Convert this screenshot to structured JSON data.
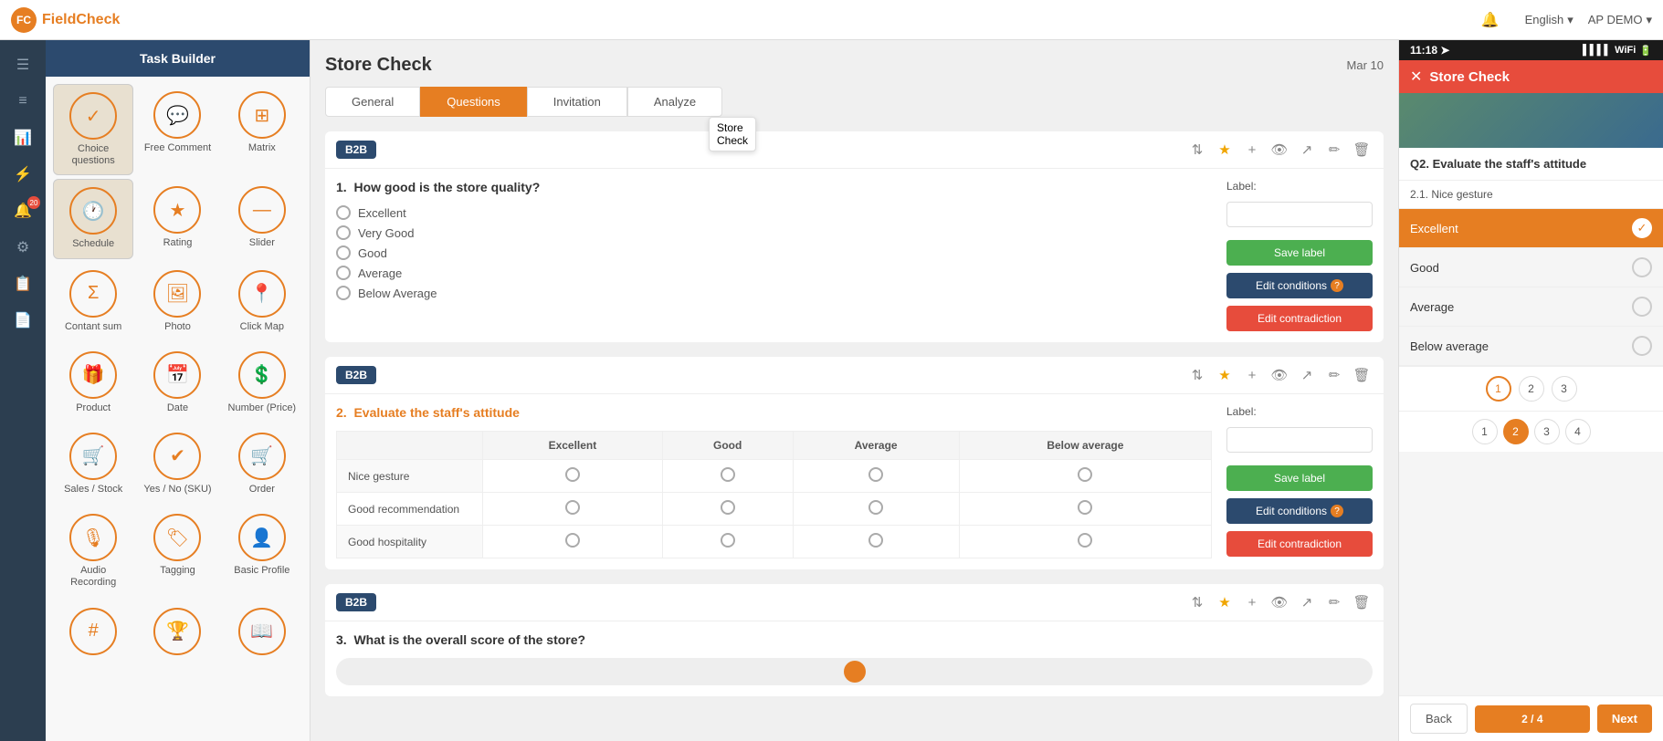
{
  "topbar": {
    "logo_text": "FieldCheck",
    "notification_icon": "🔔",
    "language": "English",
    "language_arrow": "▾",
    "user": "AP DEMO",
    "user_arrow": "▾"
  },
  "nav_sidebar": {
    "items": [
      {
        "icon": "☰",
        "name": "menu",
        "active": false
      },
      {
        "icon": "≡",
        "name": "list",
        "active": false
      },
      {
        "icon": "📊",
        "name": "analytics",
        "active": false
      },
      {
        "icon": "⚡",
        "name": "tasks",
        "active": true
      },
      {
        "icon": "🔔",
        "name": "notifications",
        "active": false,
        "badge": "20"
      },
      {
        "icon": "⚙",
        "name": "settings",
        "active": false
      },
      {
        "icon": "📋",
        "name": "reports",
        "active": false
      },
      {
        "icon": "📄",
        "name": "documents",
        "active": false
      }
    ]
  },
  "task_builder": {
    "header": "Task Builder",
    "items": [
      {
        "icon": "✓",
        "label": "Choice questions",
        "selected": true
      },
      {
        "icon": "💬",
        "label": "Free Comment"
      },
      {
        "icon": "⊞",
        "label": "Matrix"
      },
      {
        "icon": "🕐",
        "label": "Schedule",
        "selected": true
      },
      {
        "icon": "★",
        "label": "Rating"
      },
      {
        "icon": "—",
        "label": "Slider"
      },
      {
        "icon": "Σ",
        "label": "Contant sum"
      },
      {
        "icon": "🖼",
        "label": "Photo"
      },
      {
        "icon": "📍",
        "label": "Click Map"
      },
      {
        "icon": "🎁",
        "label": "Product"
      },
      {
        "icon": "📅",
        "label": "Date"
      },
      {
        "icon": "💲",
        "label": "Number (Price)"
      },
      {
        "icon": "🛒",
        "label": "Sales / Stock"
      },
      {
        "icon": "✔",
        "label": "Yes / No (SKU)"
      },
      {
        "icon": "🛒",
        "label": "Order"
      },
      {
        "icon": "🎙",
        "label": "Audio Recording"
      },
      {
        "icon": "🏷",
        "label": "Tagging"
      },
      {
        "icon": "👤",
        "label": "Basic Profile"
      },
      {
        "icon": "#",
        "label": ""
      },
      {
        "icon": "🏆",
        "label": ""
      },
      {
        "icon": "📖",
        "label": ""
      }
    ]
  },
  "store_check": {
    "title": "Store Check",
    "tooltip": "Store Check",
    "date": "Mar 10",
    "tabs": [
      "General",
      "Questions",
      "Invitation",
      "Analyze"
    ],
    "active_tab": "Questions"
  },
  "question1": {
    "badge": "B2B",
    "number": "1.",
    "text": "How good is the store quality?",
    "options": [
      "Excellent",
      "Very Good",
      "Good",
      "Average",
      "Below Average"
    ],
    "label_placeholder": "",
    "save_label": "Save label",
    "edit_conditions": "Edit conditions",
    "edit_contradiction": "Edit contradiction"
  },
  "question2": {
    "badge": "B2B",
    "number": "2.",
    "text": "Evaluate the staff's attitude",
    "columns": [
      "Excellent",
      "Good",
      "Average",
      "Below average"
    ],
    "rows": [
      "Nice gesture",
      "Good recommendation",
      "Good hospitality"
    ],
    "label_placeholder": "",
    "save_label": "Save label",
    "edit_conditions": "Edit conditions",
    "edit_contradiction": "Edit contradiction"
  },
  "question3": {
    "badge": "B2B",
    "number": "3.",
    "text": "What is the overall score of the store?"
  },
  "mobile_preview": {
    "time": "11:18",
    "title": "Store Check",
    "question_header": "Q2. Evaluate the staff's attitude",
    "sub_section": "2.1. Nice gesture",
    "options": [
      "Excellent",
      "Good",
      "Average",
      "Below average"
    ],
    "selected_option": "Excellent",
    "page_dots": [
      "1",
      "2",
      "3"
    ],
    "active_page": "1",
    "footer_back": "Back",
    "footer_progress": "2 / 4",
    "footer_next": "Next",
    "pagination_circles": [
      "1",
      "2",
      "3",
      "4"
    ],
    "active_pagination": "2"
  }
}
